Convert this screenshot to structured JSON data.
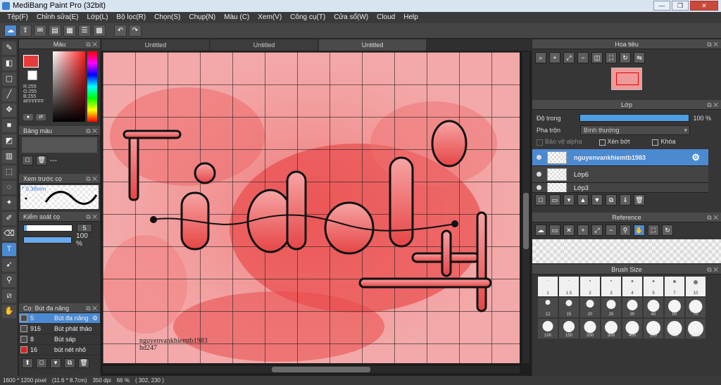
{
  "window": {
    "title": "MediBang Paint Pro (32bit)"
  },
  "menu": [
    "Tệp(F)",
    "Chỉnh sửa(E)",
    "Lớp(L)",
    "Bộ lọc(R)",
    "Chọn(S)",
    "Chụp(N)",
    "Màu (C)",
    "Xem(V)",
    "Công cụ(T)",
    "Cửa sổ(W)",
    "Cloud",
    "Help"
  ],
  "color_panel": {
    "title": "Màu",
    "r": "R:255",
    "g": "G:255",
    "b": "B:255",
    "hex": "#FFFFFF",
    "fg_color": "#e63b3b"
  },
  "palette_panel": {
    "title": "Bảng màu",
    "dash": "---"
  },
  "brush_preview": {
    "title": "Xem trước cọ",
    "size": "* 0.36mm"
  },
  "brush_control": {
    "title": "Kiểm soát cọ",
    "size_value": "5",
    "opacity_value": "100 %",
    "opacity_fraction": 1.0
  },
  "brush_list": {
    "title": "Cọ: Bút đa năng",
    "items": [
      {
        "size": "5",
        "name": "Bút đa năng",
        "color": "#4b4b4b"
      },
      {
        "size": "916",
        "name": "Bút phát thảo",
        "color": "#4b4b4b"
      },
      {
        "size": "8",
        "name": "Bút sáp",
        "color": "#4b4b4b"
      },
      {
        "size": "16",
        "name": "bút nét nhỏ",
        "color": "#e02020"
      }
    ]
  },
  "doc_tabs": [
    "Untitled",
    "Untitled",
    "Untitled"
  ],
  "canvas": {
    "signature_line1": "nguyenvankhiemtb1983",
    "signature_line2": "hd247"
  },
  "navigator": {
    "title": "Hoa tiêu"
  },
  "layers": {
    "title": "Lớp",
    "opacity_label": "Độ trong",
    "opacity_value": "100 %",
    "blend_label": "Pha trộn",
    "blend_value": "Bình thường",
    "protect_alpha": "Bảo vệ alpha",
    "clipping": "Xén bớt",
    "lock": "Khóa",
    "items": [
      {
        "name": "nguyenvankhiemtb1983",
        "selected": true
      },
      {
        "name": "Lớp6",
        "selected": false
      },
      {
        "name": "Lớp3",
        "selected": false
      }
    ]
  },
  "reference": {
    "title": "Reference"
  },
  "brush_size": {
    "title": "Brush Size",
    "sizes": [
      "1",
      "1.5",
      "2",
      "3",
      "4",
      "5",
      "7",
      "10",
      "12",
      "15",
      "20",
      "25",
      "30",
      "40",
      "50",
      "70",
      "100",
      "150",
      "200",
      "300",
      "400",
      "500",
      "700",
      "1000"
    ]
  },
  "status": {
    "size": "1600 * 1200 pixel",
    "physical": "(11.6 * 8.7cm)",
    "dpi": "350 dpi",
    "zoom": "66 %",
    "coords": "( 302, 230 )"
  }
}
